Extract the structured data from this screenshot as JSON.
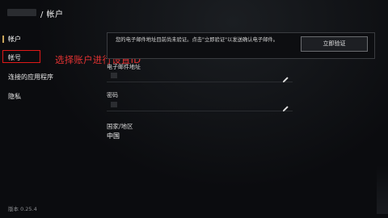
{
  "header": {
    "title": "/ 帐户"
  },
  "sidebar": {
    "items": [
      {
        "label": "帐户"
      },
      {
        "label": "帐号"
      },
      {
        "label": "连接的应用程序"
      },
      {
        "label": "隐私"
      }
    ],
    "version": "版本 0.25.4"
  },
  "annotation": {
    "text": "选择账户进行设置ID"
  },
  "notice": {
    "text": "您的电子邮件地址目前尚未验证。点击\"立即验证\"以发送确认电子邮件。",
    "button_label": "立即验证"
  },
  "fields": {
    "email_label": "电子邮件地址",
    "password_label": "密码",
    "region_label": "国家/地区",
    "region_value": "中国"
  },
  "colors": {
    "accent": "#c9a55a",
    "annotation": "#e01818"
  }
}
